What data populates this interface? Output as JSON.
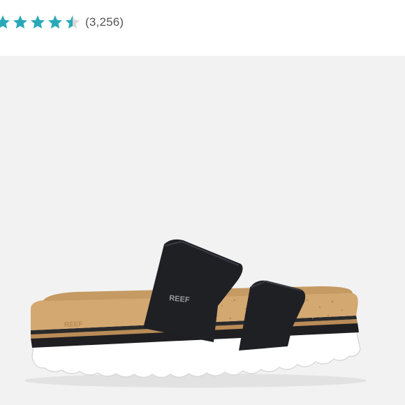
{
  "rating": {
    "stars_filled": 4.5,
    "stars_total": 5,
    "review_count": "(3,256)",
    "star_color": "#29a9b8",
    "star_empty_color": "#d8d8d8"
  },
  "product_image": {
    "alt": "Black two-strap slide sandal on cork footbed with white wavy sole",
    "brand_mark": "REEF"
  },
  "colors": {
    "background": "#f2f2f2",
    "strap": "#1e2024",
    "cork": "#caa06a",
    "sole": "#ffffff"
  }
}
